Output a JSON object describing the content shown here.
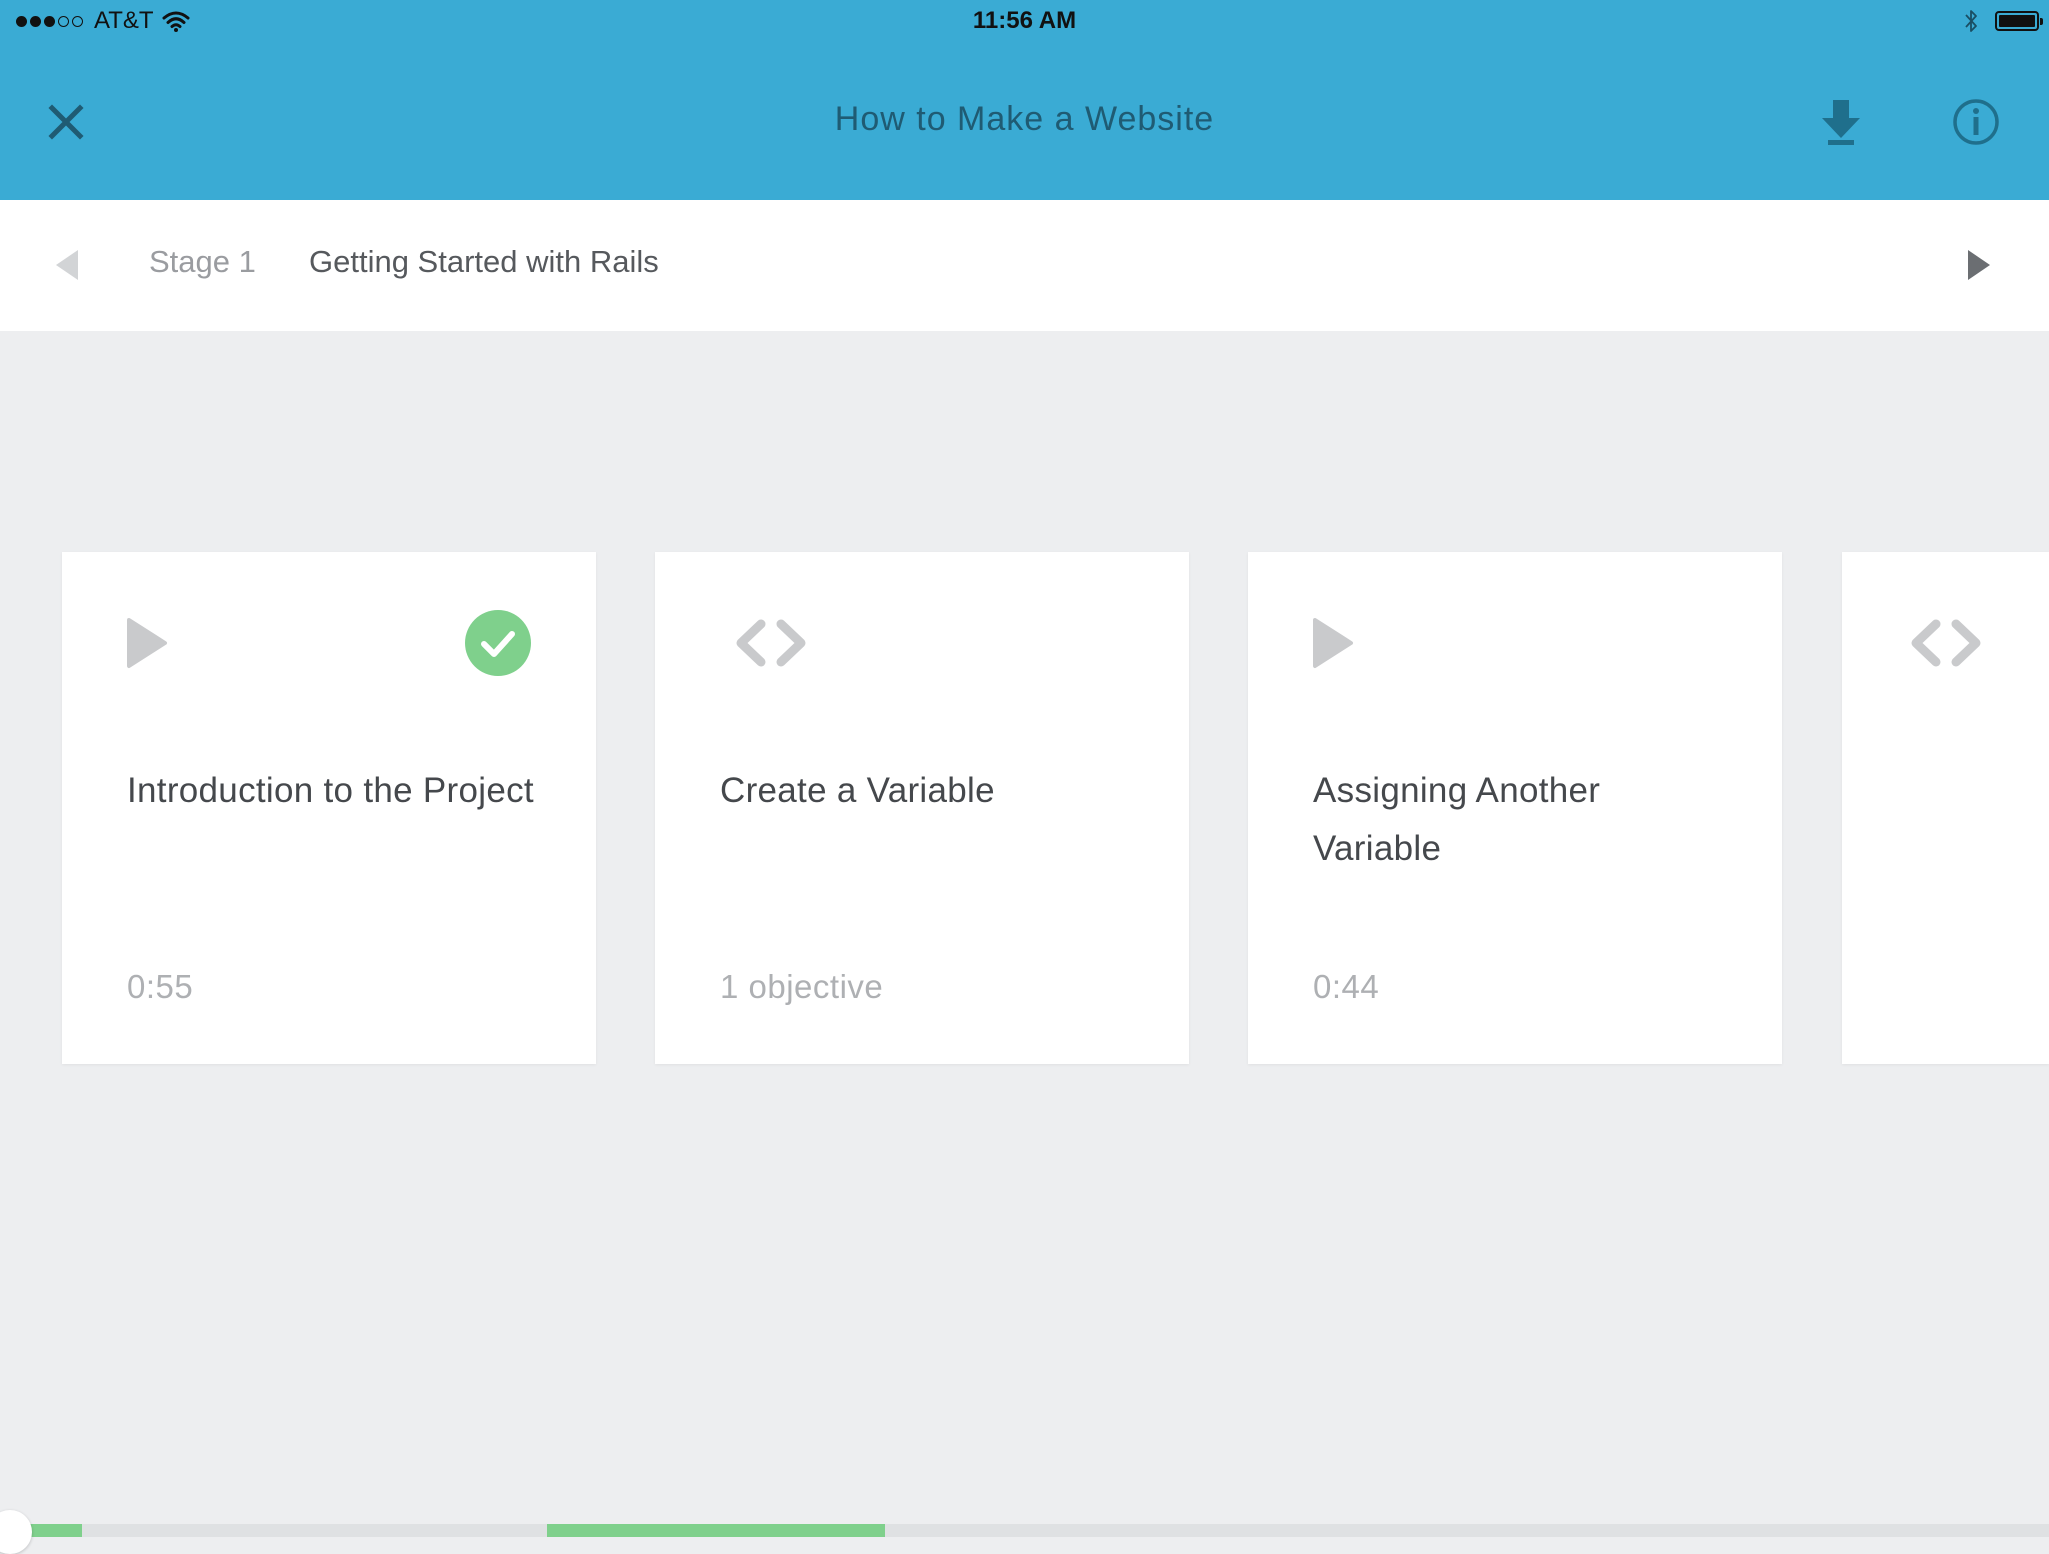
{
  "status_bar": {
    "carrier": "AT&T",
    "time": "11:56 AM",
    "signal_bars_filled": 3,
    "signal_bars_total": 5
  },
  "nav": {
    "title": "How to Make a Website",
    "close_icon": "close-icon",
    "download_icon": "download-icon",
    "info_icon": "info-icon"
  },
  "stage": {
    "label": "Stage 1",
    "title": "Getting Started with Rails"
  },
  "cards": [
    {
      "type": "video",
      "title": "Introduction to the Project",
      "meta": "0:55",
      "completed": true
    },
    {
      "type": "code-challenge",
      "title": "Create a Variable",
      "meta": "1 objective",
      "completed": false
    },
    {
      "type": "video",
      "title": "Assigning Another Variable",
      "meta": "0:44",
      "completed": false
    },
    {
      "type": "code-challenge",
      "title": "",
      "meta": "",
      "completed": false
    }
  ],
  "colors": {
    "header": "#3aabd4",
    "title_text": "#1f5b73",
    "complete_green": "#7fd08c",
    "background": "#edeef0"
  }
}
